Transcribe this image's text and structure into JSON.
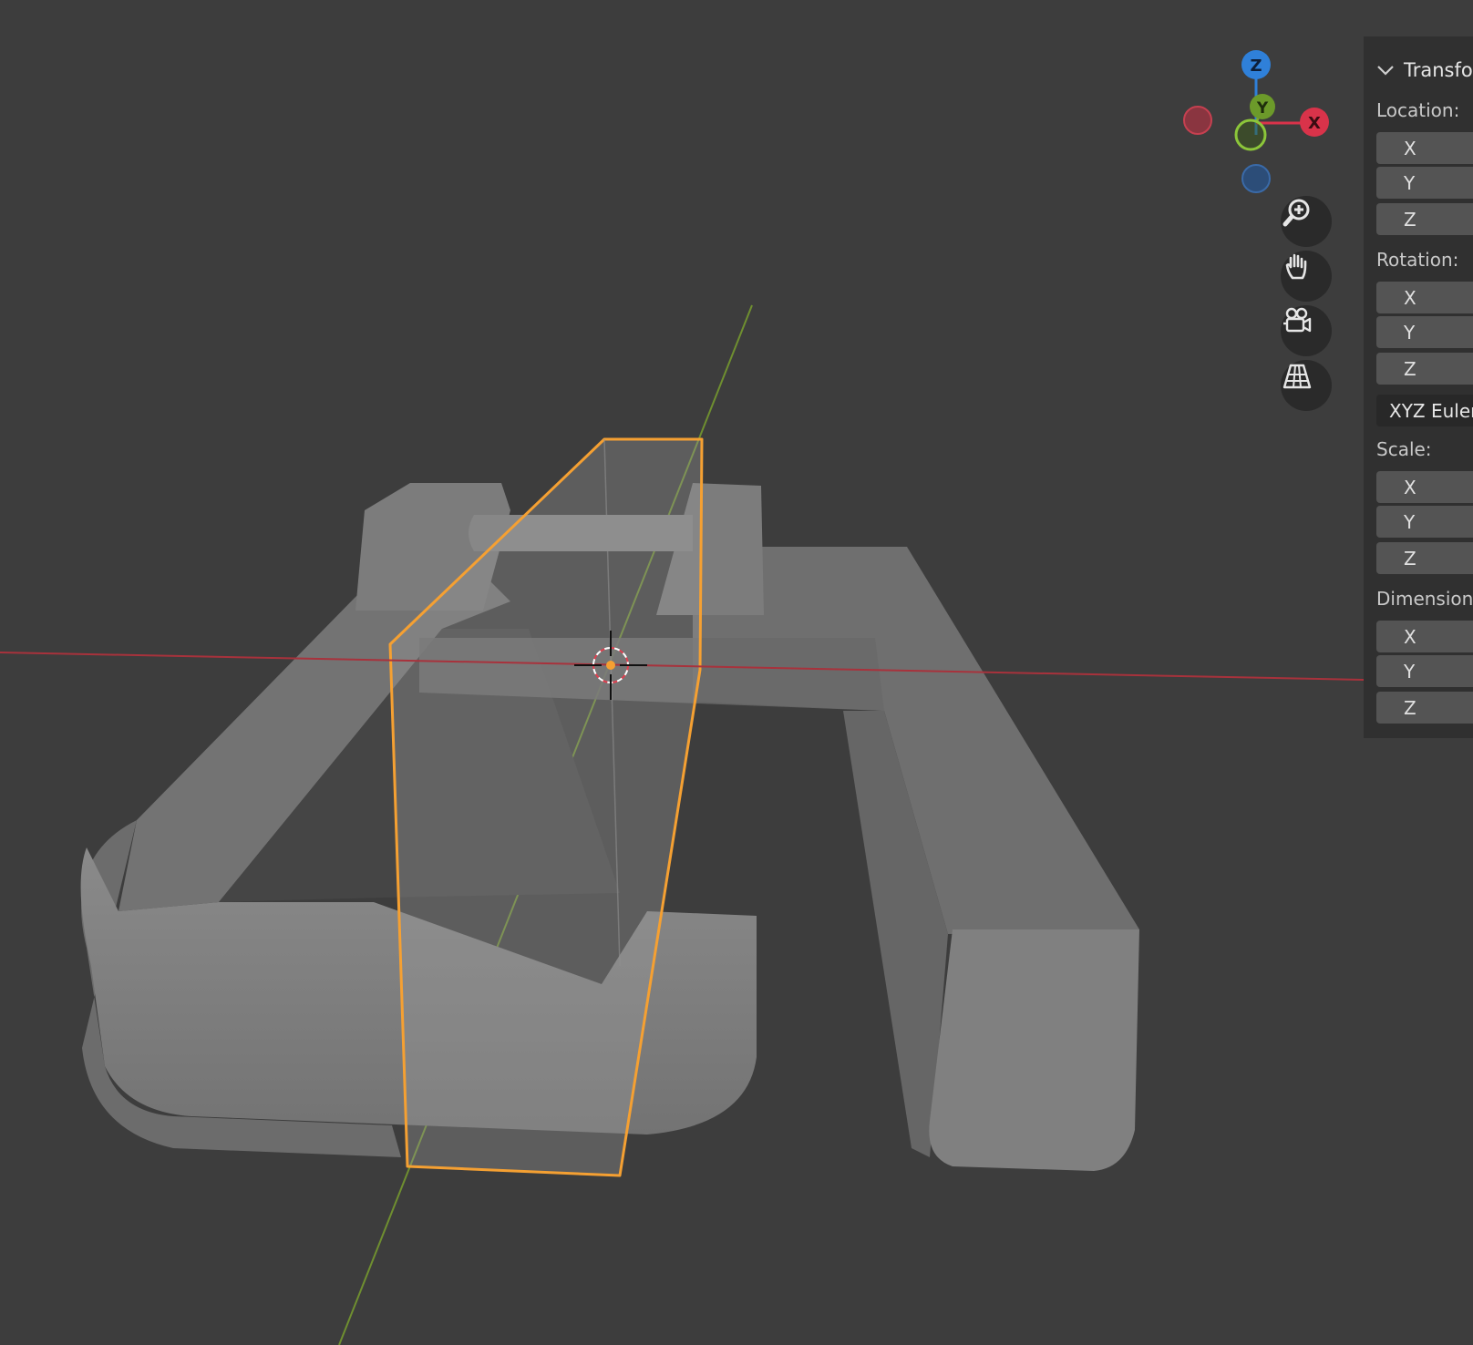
{
  "gizmo": {
    "z_label": "Z",
    "y_label": "Y",
    "x_label": "X"
  },
  "nav_buttons": [
    {
      "name": "zoom-icon"
    },
    {
      "name": "hand-pan-icon"
    },
    {
      "name": "camera-view-icon"
    },
    {
      "name": "perspective-grid-icon"
    }
  ],
  "panel": {
    "header": "Transform",
    "location": {
      "label": "Location:",
      "fields": [
        "X",
        "Y",
        "Z"
      ]
    },
    "rotation": {
      "label": "Rotation:",
      "fields": [
        "X",
        "Y",
        "Z"
      ],
      "mode": "XYZ Euler"
    },
    "scale": {
      "label": "Scale:",
      "fields": [
        "X",
        "Y",
        "Z"
      ]
    },
    "dimensions": {
      "label": "Dimensions:",
      "fields": [
        "X",
        "Y",
        "Z"
      ]
    }
  },
  "colors": {
    "background": "#3d3d3d",
    "selection_outline": "#f5a032",
    "x_axis": "#d9334a",
    "y_axis": "#7fa832",
    "z_axis": "#2f80d9"
  }
}
